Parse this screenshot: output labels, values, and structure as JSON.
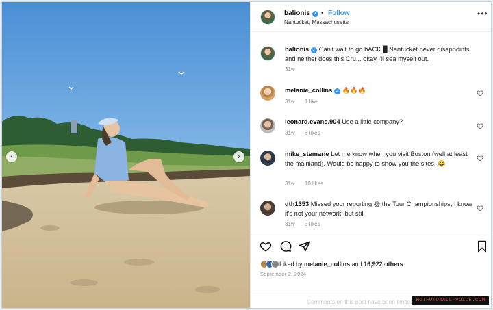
{
  "colors": {
    "link_blue": "#3b9ae8",
    "verified_blue": "#3897f0",
    "muted": "#8e8e8e",
    "watermark_red": "#e84040"
  },
  "post": {
    "username": "balionis",
    "follow_label": "Follow",
    "separator": "•",
    "location": "Nantucket, Massachusetts",
    "more_icon": "ellipsis-icon",
    "caption": "Can't wait to go bACK █ Nantucket never disappoints and neither does this Cru... okay I'll sea myself out.",
    "caption_time": "31w"
  },
  "comments": [
    {
      "username": "melanie_collins",
      "verified": true,
      "text": "🔥🔥🔥",
      "time": "31w",
      "likes": "1 like"
    },
    {
      "username": "leonard.evans.904",
      "verified": false,
      "text": "Use a little company?",
      "time": "31w",
      "likes": "6 likes"
    },
    {
      "username": "mike_stemarie",
      "verified": false,
      "text": "Let me know when you visit Boston (well at least the mainland). Would be happy to show you the sites. 😂",
      "time": "31w",
      "likes": "10 likes"
    },
    {
      "username": "dth1353",
      "verified": false,
      "text": "Missed your reporting @ the Tour Championships, I know it's not your network, but still",
      "time": "31w",
      "likes": "5 likes"
    }
  ],
  "actions": {
    "icons": [
      "heart-icon",
      "comment-icon",
      "share-icon",
      "bookmark-icon"
    ],
    "liked_by_prefix": "Liked by",
    "liked_by_user": "melanie_collins",
    "liked_by_and": "and",
    "liked_by_count": "16,922 others",
    "date": "September 2, 2024",
    "comments_disabled": "Comments on this post have been limited.",
    "watermark": "HOTFOTO4ALL-VOICE.COM"
  },
  "photo": {
    "prev_label": "‹",
    "next_label": "›"
  }
}
